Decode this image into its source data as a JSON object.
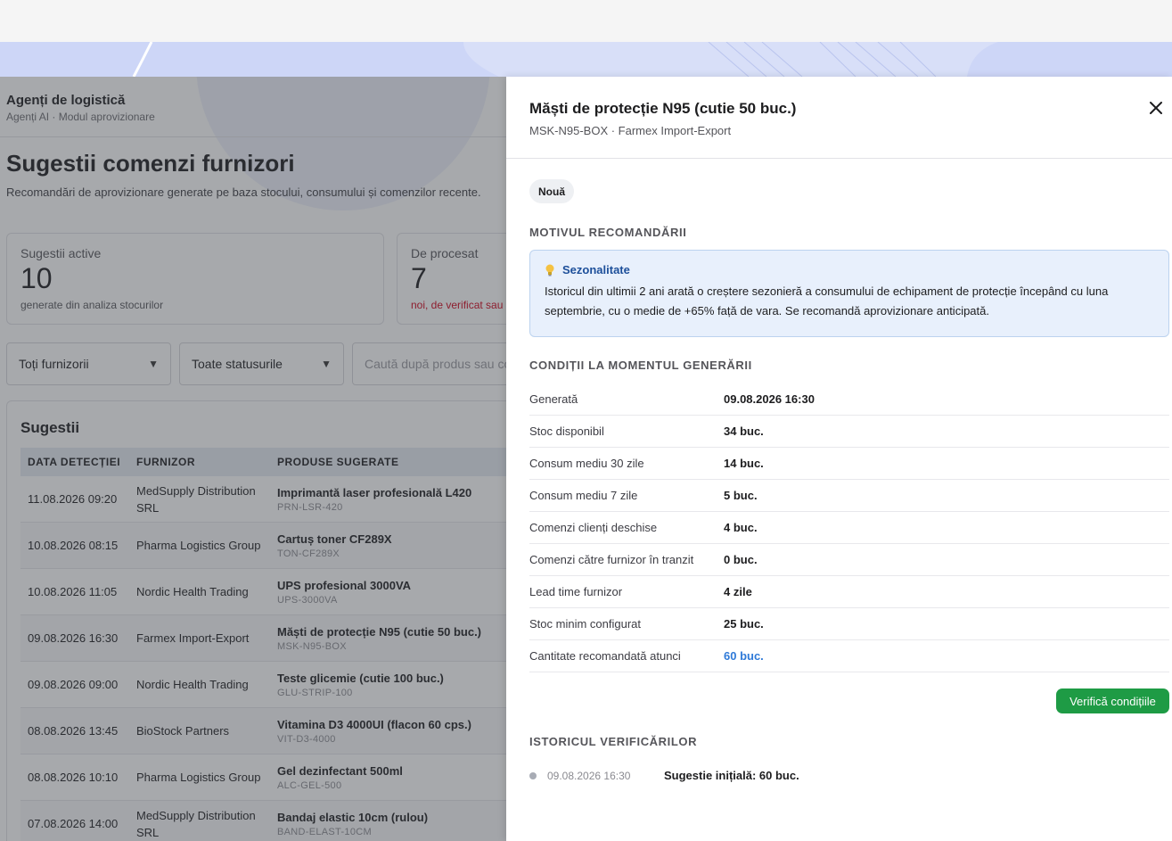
{
  "app": {
    "breadcrumb_title": "Agenți de logistică",
    "breadcrumb_sub": "Agenți AI · Modul aprovizionare",
    "page_title": "Sugestii comenzi furnizori",
    "page_subtitle": "Recomandări de aprovizionare generate pe baza stocului, consumului și comenzilor recente."
  },
  "cards": [
    {
      "label": "Sugestii active",
      "value": "10",
      "note": "generate din analiza stocurilor"
    },
    {
      "label": "De procesat",
      "value": "7",
      "note": "noi, de verificat sau"
    }
  ],
  "filters": {
    "supplier": "Toți furnizorii",
    "status": "Toate statusurile",
    "search_placeholder": "Caută după produs sau cod"
  },
  "table": {
    "title": "Sugestii",
    "headers": [
      "DATA DETECȚIEI",
      "FURNIZOR",
      "PRODUSE SUGERATE"
    ],
    "rows": [
      {
        "date": "11.08.2026 09:20",
        "supplier": "MedSupply Distribution SRL",
        "product": "Imprimantă laser profesională L420",
        "code": "PRN-LSR-420"
      },
      {
        "date": "10.08.2026 08:15",
        "supplier": "Pharma Logistics Group",
        "product": "Cartuș toner CF289X",
        "code": "TON-CF289X"
      },
      {
        "date": "10.08.2026 11:05",
        "supplier": "Nordic Health Trading",
        "product": "UPS profesional 3000VA",
        "code": "UPS-3000VA"
      },
      {
        "date": "09.08.2026 16:30",
        "supplier": "Farmex Import-Export",
        "product": "Măști de protecție N95 (cutie 50 buc.)",
        "code": "MSK-N95-BOX"
      },
      {
        "date": "09.08.2026 09:00",
        "supplier": "Nordic Health Trading",
        "product": "Teste glicemie (cutie 100 buc.)",
        "code": "GLU-STRIP-100"
      },
      {
        "date": "08.08.2026 13:45",
        "supplier": "BioStock Partners",
        "product": "Vitamina D3 4000UI (flacon 60 cps.)",
        "code": "VIT-D3-4000"
      },
      {
        "date": "08.08.2026 10:10",
        "supplier": "Pharma Logistics Group",
        "product": "Gel dezinfectant 500ml",
        "code": "ALC-GEL-500"
      },
      {
        "date": "07.08.2026 14:00",
        "supplier": "MedSupply Distribution SRL",
        "product": "Bandaj elastic 10cm (rulou)",
        "code": "BAND-ELAST-10CM"
      }
    ]
  },
  "panel": {
    "title": "Măști de protecție N95 (cutie 50 buc.)",
    "subtitle": "MSK-N95-BOX · Farmex Import-Export",
    "badge": "Nouă",
    "reason_heading": "MOTIVUL RECOMANDĂRII",
    "reason_title": "Sezonalitate",
    "reason_text": "Istoricul din ultimii 2 ani arată o creștere sezonieră a consumului de echipament de protecție începând cu luna septembrie, cu o medie de +65% față de vara. Se recomandă aprovizionare anticipată.",
    "conditions_heading": "CONDIȚII LA MOMENTUL GENERĂRII",
    "conditions": [
      {
        "label": "Generată",
        "value": "09.08.2026 16:30"
      },
      {
        "label": "Stoc disponibil",
        "value": "34 buc."
      },
      {
        "label": "Consum mediu 30 zile",
        "value": "14 buc."
      },
      {
        "label": "Consum mediu 7 zile",
        "value": "5 buc."
      },
      {
        "label": "Comenzi clienți deschise",
        "value": "4 buc."
      },
      {
        "label": "Comenzi către furnizor în tranzit",
        "value": "0 buc."
      },
      {
        "label": "Lead time furnizor",
        "value": "4 zile"
      },
      {
        "label": "Stoc minim configurat",
        "value": "25 buc."
      },
      {
        "label": "Cantitate recomandată atunci",
        "value": "60 buc."
      }
    ],
    "verify_button": "Verifică condițiile",
    "history_heading": "ISTORICUL VERIFICĂRILOR",
    "history": [
      {
        "date": "09.08.2026 16:30",
        "text": "Sugestie inițială: 60 buc."
      }
    ]
  },
  "colors": {
    "accent_blue": "#2f7ad8",
    "success_green": "#1e9b45",
    "danger_red": "#d0021b"
  },
  "icons": [
    "close-icon",
    "lightbulb-icon",
    "chevron-down-icon"
  ]
}
